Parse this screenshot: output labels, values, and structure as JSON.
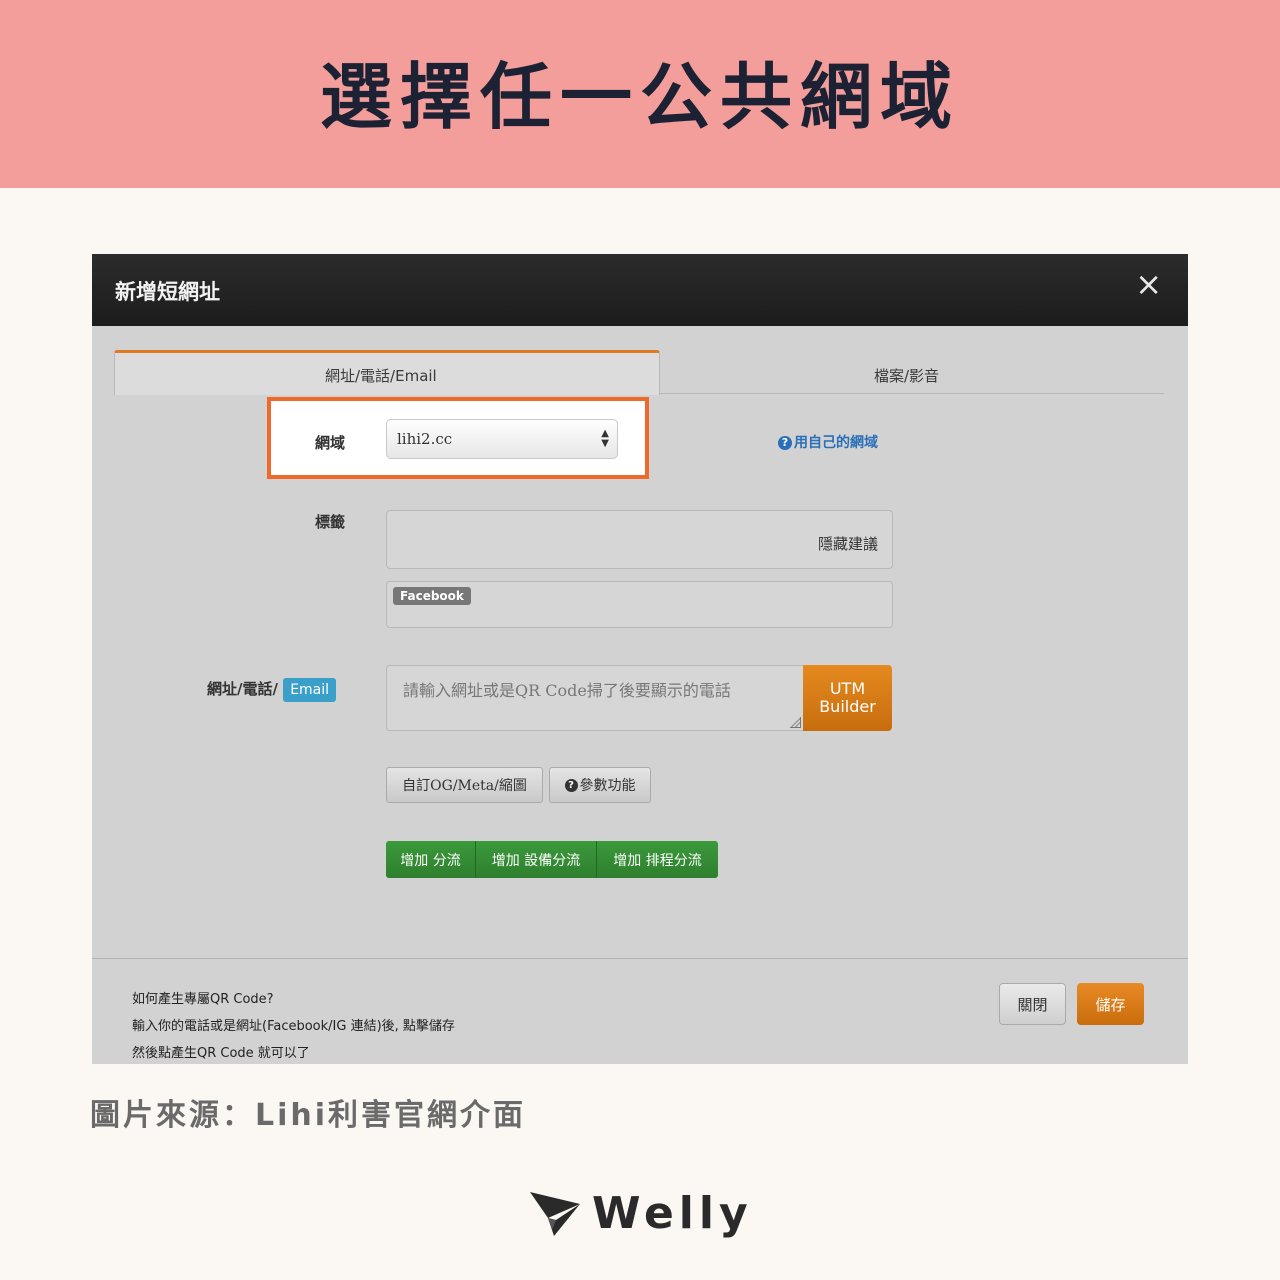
{
  "banner": {
    "title": "選擇任一公共網域"
  },
  "modal": {
    "title": "新增短網址",
    "close_symbol": "×",
    "tabs": [
      {
        "label": "網址/電話/Email",
        "active": true
      },
      {
        "label": "檔案/影音",
        "active": false
      }
    ],
    "domain": {
      "label": "網域",
      "selected": "lihi2.cc",
      "own_domain_link": "用自己的網域"
    },
    "tags": {
      "label": "標籤",
      "hide_suggestions": "隱藏建議",
      "suggested_tag": "Facebook"
    },
    "url_field": {
      "label": "網址/電話/",
      "badge": "Email",
      "placeholder": "請輸入網址或是QR Code掃了後要顯示的電話",
      "utm_line1": "UTM",
      "utm_line2": "Builder"
    },
    "option_buttons": {
      "og_meta": "自訂OG/Meta/縮圖",
      "params": "參數功能"
    },
    "split_buttons": [
      "增加 分流",
      "增加 設備分流",
      "增加 排程分流"
    ],
    "footer_notes": [
      "如何產生專屬QR Code?",
      "輸入你的電話或是網址(Facebook/IG 連結)後, 點擊儲存",
      "然後點產生QR Code 就可以了"
    ],
    "close_button": "關閉",
    "save_button": "儲存"
  },
  "caption": "圖片來源：Lihi利害官網介面",
  "logo": {
    "text": "Welly"
  },
  "colors": {
    "banner_bg": "#f49e9c",
    "highlight": "#ef6a2a",
    "accent_orange": "#e07a1f",
    "green": "#3b9a3b",
    "link_blue": "#2a70b8"
  }
}
